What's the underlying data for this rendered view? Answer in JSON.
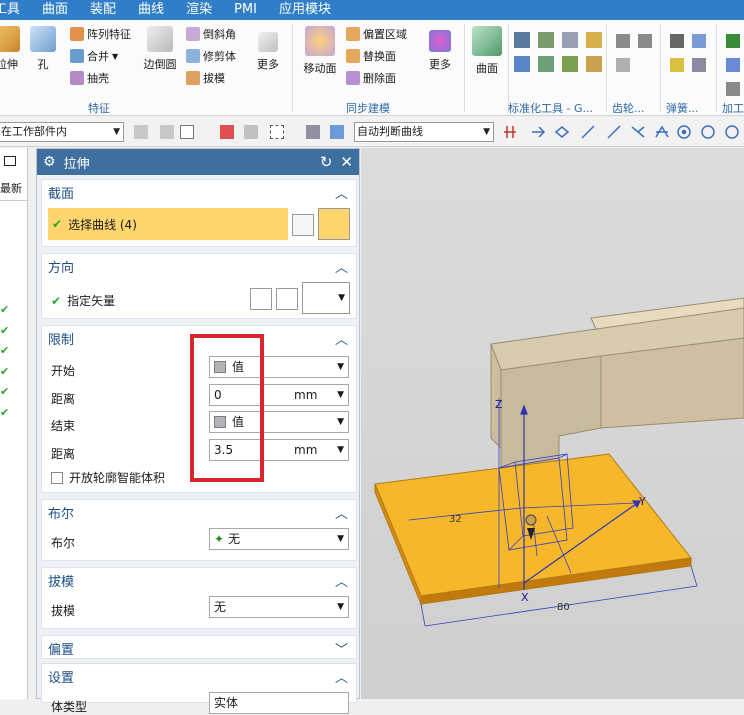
{
  "menu": [
    "工具",
    "曲面",
    "装配",
    "曲线",
    "渲染",
    "PMI",
    "应用模块"
  ],
  "ribbon": {
    "feature_group": {
      "label": "特征",
      "items": [
        {
          "label": "拉伸",
          "icon": "extrude-icon"
        },
        {
          "label": "孔",
          "icon": "hole-icon"
        },
        {
          "label": "阵列特征",
          "icon": "pattern-feature-icon"
        },
        {
          "label": "合并",
          "icon": "unite-icon"
        },
        {
          "label": "抽壳",
          "icon": "shell-icon"
        },
        {
          "label": "边倒圆",
          "icon": "edge-blend-icon"
        },
        {
          "label": "倒斜角",
          "icon": "chamfer-icon"
        },
        {
          "label": "修剪体",
          "icon": "trim-body-icon"
        },
        {
          "label": "拔模",
          "icon": "draft-icon"
        },
        {
          "label": "更多",
          "icon": "more-icon"
        }
      ]
    },
    "sync_group": {
      "label": "同步建模",
      "items": [
        {
          "label": "移动面",
          "icon": "move-face-icon"
        },
        {
          "label": "偏置区域",
          "icon": "offset-region-icon"
        },
        {
          "label": "替换面",
          "icon": "replace-face-icon"
        },
        {
          "label": "删除面",
          "icon": "delete-face-icon"
        },
        {
          "label": "更多",
          "icon": "more-icon"
        }
      ]
    },
    "surface": {
      "label": "曲面",
      "icon": "surface-icon"
    },
    "standard_group": {
      "label": "标准化工具 - G..."
    },
    "gear_group": {
      "label": "齿轮..."
    },
    "spring_group": {
      "label": "弹簧..."
    },
    "machining_group": {
      "label": "加工"
    }
  },
  "toolbar": {
    "filter_combo": "在工作部件内",
    "curve_rule_combo": "自动判断曲线"
  },
  "left_strip": {
    "header": "最新",
    "checks": [
      "✔",
      "✔",
      "✔",
      "✔",
      "✔",
      "✔"
    ]
  },
  "dialog": {
    "title": "拉伸",
    "section_section": {
      "title": "截面",
      "select_curve": "选择曲线 (4)"
    },
    "direction_section": {
      "title": "方向",
      "specify_vector": "指定矢量"
    },
    "limits_section": {
      "title": "限制",
      "start_label": "开始",
      "start_value": "值",
      "distance1_label": "距离",
      "distance1_value": "0",
      "distance1_unit": "mm",
      "end_label": "结束",
      "end_value": "值",
      "distance2_label": "距离",
      "distance2_value": "3.5",
      "distance2_unit": "mm",
      "open_profile_label": "开放轮廓智能体积"
    },
    "boolean_section": {
      "title": "布尔",
      "label": "布尔",
      "value": "无"
    },
    "draft_section": {
      "title": "拔模",
      "label": "拔模",
      "value": "无"
    },
    "offset_section": {
      "title": "偏置"
    },
    "settings_section": {
      "title": "设置",
      "partial_label": "体类型",
      "partial_value": "实体"
    }
  },
  "viewport": {
    "axis_labels": {
      "x": "X",
      "y": "Y",
      "z": "Z"
    },
    "dims": {
      "d1": "32",
      "d2": "80"
    }
  },
  "colors": {
    "menubar": "#2f7ec7",
    "dialog_title": "#3f6f9f",
    "section_highlight": "#ffd66e",
    "plate": "#f6b72a",
    "red_box": "#d8272c",
    "check": "#2aa52a"
  }
}
